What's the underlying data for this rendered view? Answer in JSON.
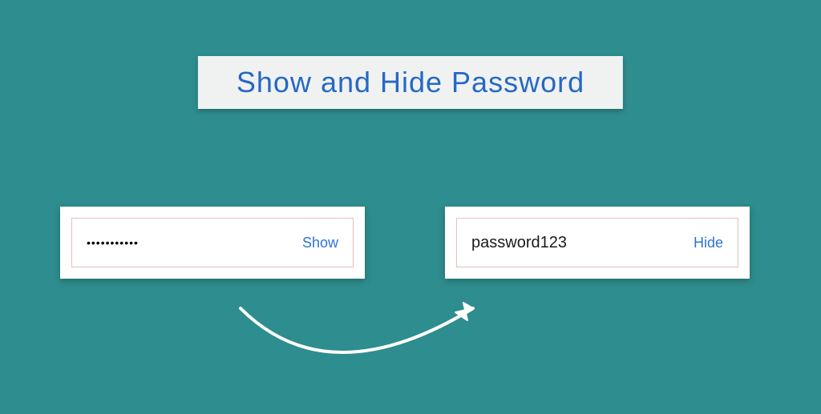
{
  "title": "Show and Hide Password",
  "left_card": {
    "masked_value": "•••••••••••",
    "toggle_label": "Show"
  },
  "right_card": {
    "revealed_value": "password123",
    "toggle_label": "Hide"
  }
}
